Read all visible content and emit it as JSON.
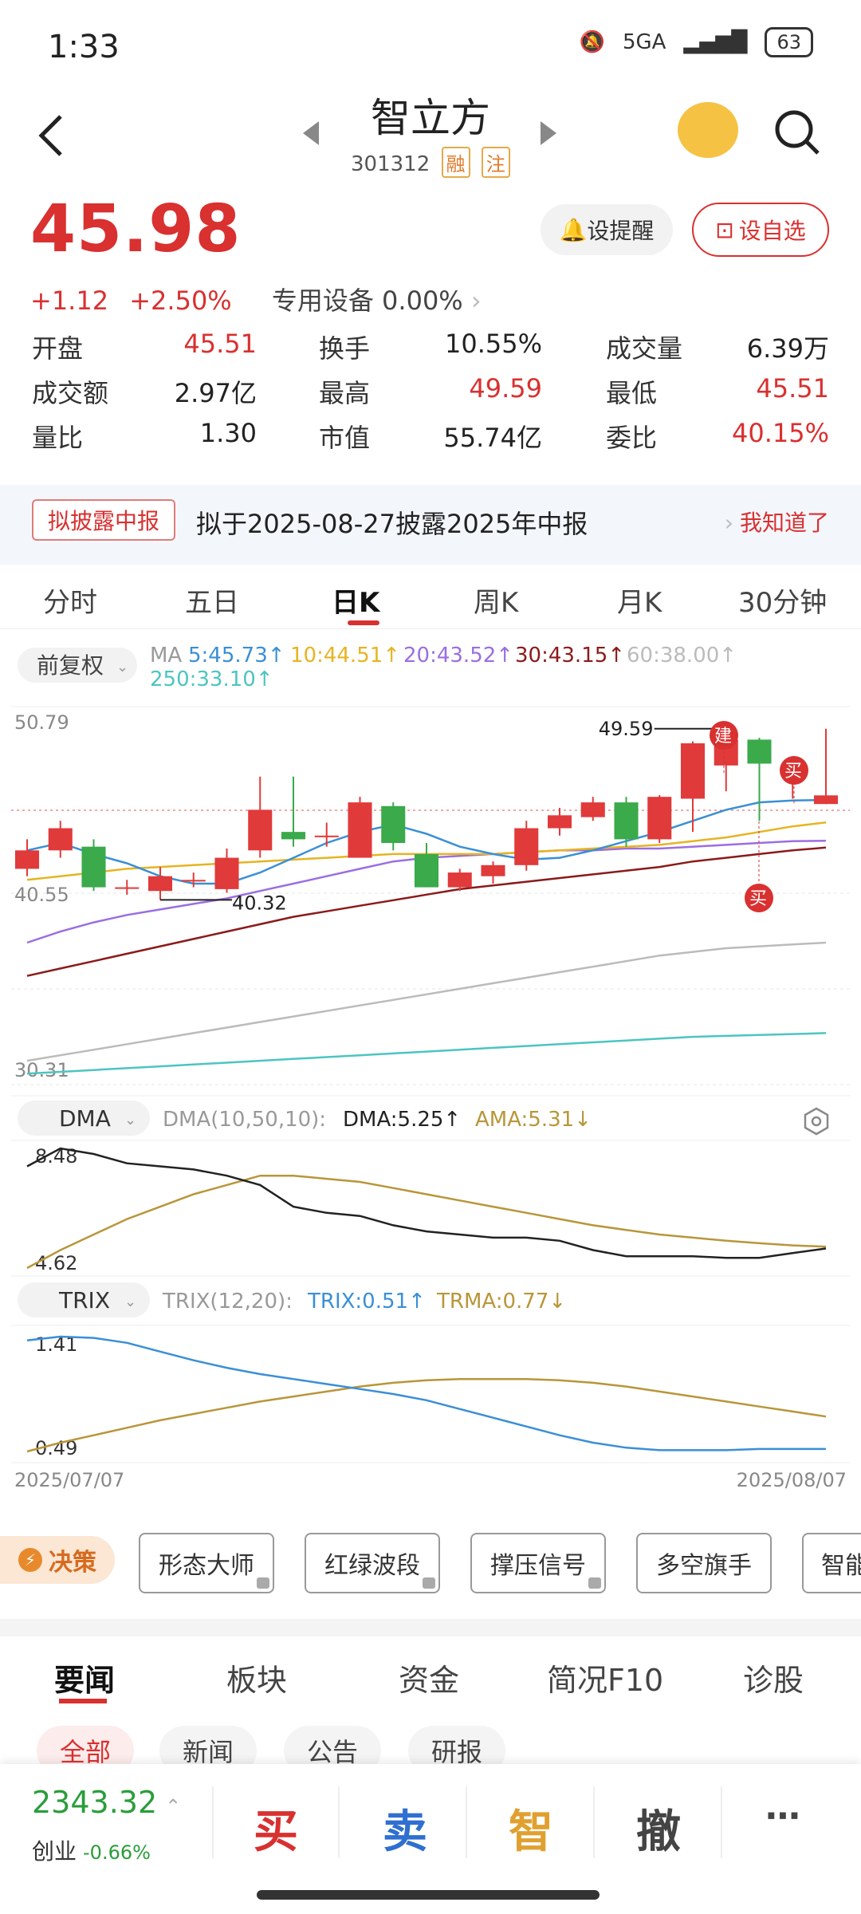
{
  "status_bar": {
    "time": "1:33",
    "network": "5GA",
    "battery": "63"
  },
  "header": {
    "name": "智立方",
    "code": "301312",
    "tags": [
      "融",
      "注"
    ]
  },
  "quote": {
    "price": "45.98",
    "change": "+1.12",
    "change_pct": "+2.50%",
    "sector": "专用设备 0.00%",
    "remind_label": "设提醒",
    "watch_label": "设自选"
  },
  "stats": [
    [
      {
        "label": "开盘",
        "value": "45.51",
        "color": "red"
      },
      {
        "label": "换手",
        "value": "10.55%",
        "color": "black"
      },
      {
        "label": "成交量",
        "value": "6.39万",
        "color": "black"
      }
    ],
    [
      {
        "label": "成交额",
        "value": "2.97亿",
        "color": "black"
      },
      {
        "label": "最高",
        "value": "49.59",
        "color": "red"
      },
      {
        "label": "最低",
        "value": "45.51",
        "color": "red"
      }
    ],
    [
      {
        "label": "量比",
        "value": "1.30",
        "color": "black"
      },
      {
        "label": "市值",
        "value": "55.74亿",
        "color": "black"
      },
      {
        "label": "委比",
        "value": "40.15%",
        "color": "red"
      }
    ]
  ],
  "notice": {
    "tag": "拟披露中报",
    "text": "拟于2025-08-27披露2025年中报",
    "action": "我知道了"
  },
  "period_tabs": [
    "分时",
    "五日",
    "日K",
    "周K",
    "月K",
    "30分钟"
  ],
  "active_period": "日K",
  "chart": {
    "adjust_label": "前复权",
    "ma_label": "MA",
    "ma": [
      {
        "text": "5:45.73↑",
        "color": "#3a8fd6"
      },
      {
        "text": "10:44.51↑",
        "color": "#e6b422"
      },
      {
        "text": "20:43.52↑",
        "color": "#9b6ee0"
      },
      {
        "text": "30:43.15↑",
        "color": "#8b1a1a"
      },
      {
        "text": "60:38.00↑",
        "color": "#bbbbbb"
      },
      {
        "text": "250:33.10↑",
        "color": "#4cc5c0"
      }
    ],
    "y_top": "50.79",
    "y_mid": "40.55",
    "y_bottom": "30.31",
    "high_label": "49.59",
    "low_label": "40.32",
    "marker_build": "建",
    "marker_buy": "买",
    "dma_name": "DMA",
    "dma_params": "DMA(10,50,10):",
    "dma_value": "DMA:5.25↑",
    "ama_value": "AMA:5.31↓",
    "dma_top": "8.48",
    "dma_bottom": "4.62",
    "trix_name": "TRIX",
    "trix_params": "TRIX(12,20):",
    "trix_value": "TRIX:0.51↑",
    "trma_value": "TRMA:0.77↓",
    "trix_top": "1.41",
    "trix_bottom": "0.49",
    "date_start": "2025/07/07",
    "date_end": "2025/08/07",
    "colors": {
      "up": "#e03a3a",
      "down": "#3aaa4a"
    }
  },
  "chart_data": {
    "type": "candlestick",
    "candles": [
      {
        "o": 42.0,
        "c": 43.0,
        "h": 43.6,
        "l": 41.6
      },
      {
        "o": 43.0,
        "c": 44.2,
        "h": 44.6,
        "l": 42.6
      },
      {
        "o": 43.2,
        "c": 41.0,
        "h": 43.6,
        "l": 40.8
      },
      {
        "o": 41.0,
        "c": 41.0,
        "h": 41.4,
        "l": 40.6
      },
      {
        "o": 40.8,
        "c": 41.6,
        "h": 42.1,
        "l": 40.32
      },
      {
        "o": 41.4,
        "c": 41.4,
        "h": 41.8,
        "l": 41.0
      },
      {
        "o": 40.9,
        "c": 42.6,
        "h": 43.1,
        "l": 40.7
      },
      {
        "o": 43.0,
        "c": 45.2,
        "h": 47.0,
        "l": 42.6
      },
      {
        "o": 44.0,
        "c": 43.6,
        "h": 47.0,
        "l": 43.2
      },
      {
        "o": 43.8,
        "c": 43.8,
        "h": 44.5,
        "l": 43.2
      },
      {
        "o": 42.6,
        "c": 45.6,
        "h": 45.9,
        "l": 42.6
      },
      {
        "o": 45.4,
        "c": 43.4,
        "h": 45.6,
        "l": 43.0
      },
      {
        "o": 42.8,
        "c": 41.0,
        "h": 43.4,
        "l": 41.0
      },
      {
        "o": 41.0,
        "c": 41.8,
        "h": 42.0,
        "l": 40.8
      },
      {
        "o": 41.6,
        "c": 42.2,
        "h": 42.4,
        "l": 41.2
      },
      {
        "o": 42.2,
        "c": 44.2,
        "h": 44.6,
        "l": 41.9
      },
      {
        "o": 44.2,
        "c": 44.9,
        "h": 45.3,
        "l": 43.8
      },
      {
        "o": 44.8,
        "c": 45.6,
        "h": 45.9,
        "l": 44.6
      },
      {
        "o": 45.6,
        "c": 43.6,
        "h": 45.9,
        "l": 43.2
      },
      {
        "o": 43.6,
        "c": 45.9,
        "h": 46.0,
        "l": 43.4
      },
      {
        "o": 45.8,
        "c": 48.8,
        "h": 48.9,
        "l": 44.0
      },
      {
        "o": 47.6,
        "c": 49.0,
        "h": 49.59,
        "l": 46.2
      },
      {
        "o": 49.0,
        "c": 47.7,
        "h": 49.1,
        "l": 44.6
      },
      {
        "o": 47.4,
        "c": 47.4,
        "h": 48.1,
        "l": 45.8
      },
      {
        "o": 45.51,
        "c": 45.98,
        "h": 49.59,
        "l": 45.51
      }
    ],
    "ma5": [
      43.0,
      43.4,
      42.8,
      42.3,
      41.6,
      41.2,
      41.2,
      41.8,
      42.6,
      43.4,
      44.0,
      44.4,
      43.9,
      43.2,
      42.8,
      42.5,
      42.6,
      43.0,
      43.5,
      44.0,
      44.6,
      45.2,
      45.6,
      45.7,
      45.73
    ],
    "ma10": [
      41.4,
      41.6,
      41.8,
      42.0,
      42.1,
      42.2,
      42.3,
      42.4,
      42.5,
      42.6,
      42.7,
      42.8,
      42.8,
      42.8,
      42.8,
      42.9,
      43.0,
      43.1,
      43.2,
      43.3,
      43.5,
      43.7,
      44.0,
      44.3,
      44.51
    ],
    "ma20": [
      38.0,
      38.6,
      39.1,
      39.5,
      39.8,
      40.1,
      40.4,
      40.8,
      41.2,
      41.6,
      42.0,
      42.4,
      42.6,
      42.7,
      42.8,
      42.9,
      43.0,
      43.0,
      43.1,
      43.1,
      43.2,
      43.3,
      43.4,
      43.5,
      43.52
    ],
    "ma30": [
      36.2,
      36.6,
      37.0,
      37.4,
      37.8,
      38.2,
      38.6,
      39.0,
      39.4,
      39.7,
      40.0,
      40.3,
      40.6,
      40.9,
      41.1,
      41.3,
      41.5,
      41.7,
      41.9,
      42.1,
      42.4,
      42.6,
      42.8,
      43.0,
      43.15
    ],
    "ma60": [
      31.6,
      31.9,
      32.2,
      32.5,
      32.8,
      33.1,
      33.4,
      33.7,
      34.0,
      34.3,
      34.6,
      34.9,
      35.2,
      35.5,
      35.8,
      36.1,
      36.4,
      36.7,
      37.0,
      37.3,
      37.5,
      37.7,
      37.8,
      37.9,
      38.0
    ],
    "ma250": [
      30.9,
      31.0,
      31.1,
      31.2,
      31.3,
      31.4,
      31.5,
      31.6,
      31.7,
      31.8,
      31.9,
      32.0,
      32.1,
      32.2,
      32.3,
      32.4,
      32.5,
      32.6,
      32.7,
      32.8,
      32.9,
      32.95,
      33.0,
      33.05,
      33.1
    ],
    "dma": [
      7.9,
      8.48,
      8.3,
      8.0,
      7.9,
      7.8,
      7.6,
      7.3,
      6.6,
      6.4,
      6.3,
      6.0,
      5.8,
      5.7,
      5.6,
      5.6,
      5.5,
      5.2,
      5.0,
      5.0,
      5.0,
      4.95,
      4.95,
      5.1,
      5.25
    ],
    "ama": [
      4.62,
      5.2,
      5.7,
      6.2,
      6.6,
      7.0,
      7.3,
      7.6,
      7.6,
      7.5,
      7.4,
      7.2,
      7.0,
      6.8,
      6.6,
      6.4,
      6.2,
      6.0,
      5.85,
      5.7,
      5.6,
      5.5,
      5.42,
      5.35,
      5.31
    ],
    "trix": [
      1.38,
      1.41,
      1.4,
      1.36,
      1.29,
      1.22,
      1.16,
      1.11,
      1.07,
      1.03,
      0.99,
      0.95,
      0.9,
      0.83,
      0.76,
      0.69,
      0.62,
      0.56,
      0.52,
      0.5,
      0.5,
      0.5,
      0.51,
      0.51,
      0.51
    ],
    "trma": [
      0.49,
      0.56,
      0.62,
      0.68,
      0.74,
      0.79,
      0.84,
      0.89,
      0.93,
      0.97,
      1.01,
      1.04,
      1.06,
      1.07,
      1.07,
      1.07,
      1.06,
      1.04,
      1.01,
      0.97,
      0.93,
      0.89,
      0.85,
      0.81,
      0.77
    ],
    "ylim": [
      30.31,
      50.79
    ]
  },
  "decision": {
    "label": "决策",
    "tools": [
      "形态大师",
      "红绿波段",
      "撑压信号",
      "多空旗手",
      "智能"
    ]
  },
  "news_tabs": [
    "要闻",
    "板块",
    "资金",
    "简况F10",
    "诊股"
  ],
  "news_chips": [
    "全部",
    "新闻",
    "公告",
    "研报"
  ],
  "index": {
    "value": "2343.32",
    "name": "创业",
    "change": "-0.66%"
  },
  "actions": [
    "买",
    "卖",
    "智",
    "撤",
    "⋯"
  ]
}
